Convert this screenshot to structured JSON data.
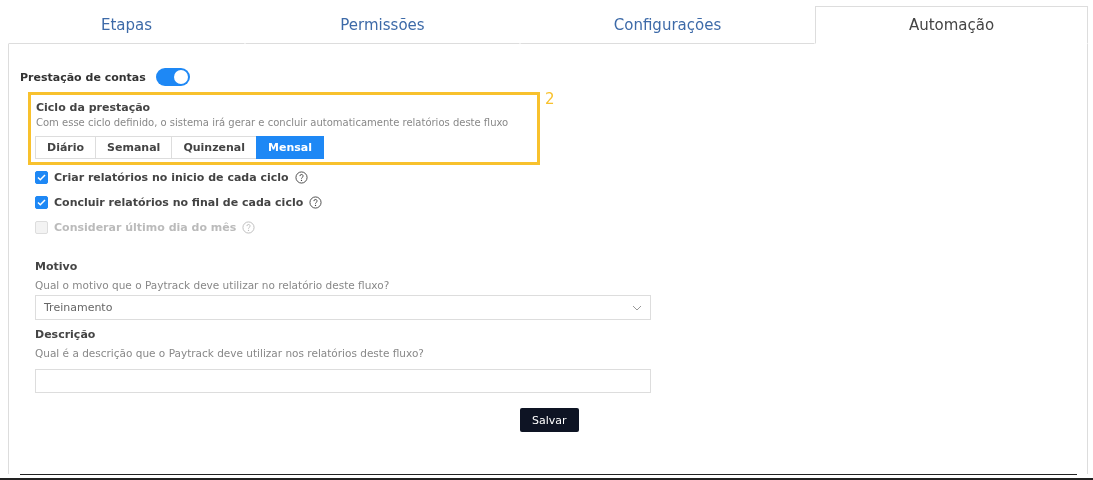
{
  "tabs": [
    {
      "label": "Etapas",
      "selected": false
    },
    {
      "label": "Permissões",
      "selected": false
    },
    {
      "label": "Configurações",
      "selected": false
    },
    {
      "label": "Automação",
      "selected": true
    }
  ],
  "toggle": {
    "label": "Prestação de contas",
    "on": true
  },
  "cycle": {
    "title": "Ciclo da prestação",
    "description": "Com esse ciclo definido, o sistema irá gerar e concluir automaticamente relatórios deste fluxo",
    "annotation": "2",
    "options": [
      {
        "label": "Diário",
        "selected": false
      },
      {
        "label": "Semanal",
        "selected": false
      },
      {
        "label": "Quinzenal",
        "selected": false
      },
      {
        "label": "Mensal",
        "selected": true
      }
    ]
  },
  "checkboxes": [
    {
      "label": "Criar relatórios no inicio de cada ciclo",
      "checked": true,
      "disabled": false
    },
    {
      "label": "Concluir relatórios no final de cada ciclo",
      "checked": true,
      "disabled": false
    },
    {
      "label": "Considerar último dia do mês",
      "checked": false,
      "disabled": true
    }
  ],
  "motivo": {
    "label": "Motivo",
    "hint": "Qual o motivo que o Paytrack deve utilizar no relatório deste fluxo?",
    "value": "Treinamento"
  },
  "descricao": {
    "label": "Descrição",
    "hint": "Qual é a descrição que o Paytrack deve utilizar nos relatórios deste fluxo?"
  },
  "save_button": "Salvar"
}
